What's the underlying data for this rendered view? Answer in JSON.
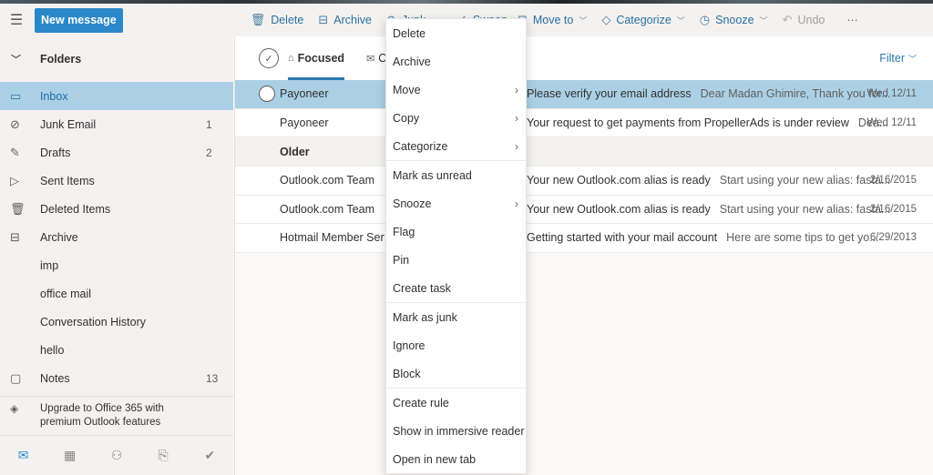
{
  "toolbar": {
    "menu_icon": "☰",
    "new_message": "New message",
    "commands": [
      {
        "icon": "🗑",
        "label": "Delete",
        "dropdown": false,
        "disabled": false
      },
      {
        "icon": "⊟",
        "label": "Archive",
        "dropdown": false,
        "disabled": false
      },
      {
        "icon": "⊘",
        "label": "Junk",
        "dropdown": true,
        "disabled": false
      },
      {
        "icon": "✓",
        "label": "Sweep",
        "dropdown": false,
        "disabled": false
      },
      {
        "icon": "⊡",
        "label": "Move to",
        "dropdown": true,
        "disabled": false
      },
      {
        "icon": "◇",
        "label": "Categorize",
        "dropdown": true,
        "disabled": false
      },
      {
        "icon": "◷",
        "label": "Snooze",
        "dropdown": true,
        "disabled": false
      },
      {
        "icon": "↶",
        "label": "Undo",
        "dropdown": false,
        "disabled": true
      }
    ],
    "more_icon": "···"
  },
  "sidebar": {
    "header": "Folders",
    "items": [
      {
        "icon": "▭",
        "label": "Inbox",
        "count": "",
        "selected": true
      },
      {
        "icon": "⊘",
        "label": "Junk Email",
        "count": "1",
        "selected": false
      },
      {
        "icon": "✎",
        "label": "Drafts",
        "count": "2",
        "selected": false
      },
      {
        "icon": "▷",
        "label": "Sent Items",
        "count": "",
        "selected": false
      },
      {
        "icon": "🗑",
        "label": "Deleted Items",
        "count": "",
        "selected": false
      },
      {
        "icon": "⊟",
        "label": "Archive",
        "count": "",
        "selected": false
      },
      {
        "icon": "",
        "label": "imp",
        "count": "",
        "selected": false
      },
      {
        "icon": "",
        "label": "office mail",
        "count": "",
        "selected": false
      },
      {
        "icon": "",
        "label": "Conversation History",
        "count": "",
        "selected": false
      },
      {
        "icon": "",
        "label": "hello",
        "count": "",
        "selected": false
      },
      {
        "icon": "▢",
        "label": "Notes",
        "count": "13",
        "selected": false
      }
    ],
    "upgrade": {
      "icon": "◈",
      "line1": "Upgrade to Office 365 with",
      "line2": "premium Outlook features"
    },
    "bottom_nav": [
      {
        "name": "mail-icon",
        "glyph": "✉",
        "active": true
      },
      {
        "name": "calendar-icon",
        "glyph": "▦",
        "active": false
      },
      {
        "name": "people-icon",
        "glyph": "⚇",
        "active": false
      },
      {
        "name": "attachment-icon",
        "glyph": "⎘",
        "active": false
      },
      {
        "name": "todo-icon",
        "glyph": "✔",
        "active": false
      }
    ]
  },
  "main": {
    "tabs": [
      {
        "icon": "⌂",
        "label": "Focused",
        "active": true
      },
      {
        "icon": "✉",
        "label": "Other",
        "active": false
      }
    ],
    "filter": "Filter",
    "messages_recent": [
      {
        "sender": "Payoneer",
        "subject": "Please verify your email address",
        "preview": "Dear Madan Ghimire, Thank you for...",
        "date": "Wed 12/11",
        "selected": true
      },
      {
        "sender": "Payoneer",
        "subject": "Your request to get payments from PropellerAds is under review",
        "preview": "Dea...",
        "date": "Wed 12/11",
        "selected": false
      }
    ],
    "group_older": "Older",
    "messages_older": [
      {
        "sender": "Outlook.com Team",
        "subject": "Your new Outlook.com alias is ready",
        "preview": "Start using your new alias: fasta...",
        "date": "2/16/2015"
      },
      {
        "sender": "Outlook.com Team",
        "subject": "Your new Outlook.com alias is ready",
        "preview": "Start using your new alias: fasta...",
        "date": "2/16/2015"
      },
      {
        "sender": "Hotmail Member Services",
        "subject": "Getting started with your mail account",
        "preview": "Here are some tips to get yo...",
        "date": "6/29/2013"
      }
    ]
  },
  "context_menu": {
    "groups": [
      [
        {
          "label": "Delete",
          "submenu": false
        },
        {
          "label": "Archive",
          "submenu": false
        },
        {
          "label": "Move",
          "submenu": true
        },
        {
          "label": "Copy",
          "submenu": true
        },
        {
          "label": "Categorize",
          "submenu": true
        }
      ],
      [
        {
          "label": "Mark as unread",
          "submenu": false
        },
        {
          "label": "Snooze",
          "submenu": true
        },
        {
          "label": "Flag",
          "submenu": false
        },
        {
          "label": "Pin",
          "submenu": false
        },
        {
          "label": "Create task",
          "submenu": false
        }
      ],
      [
        {
          "label": "Mark as junk",
          "submenu": false
        },
        {
          "label": "Ignore",
          "submenu": false
        },
        {
          "label": "Block",
          "submenu": false
        }
      ],
      [
        {
          "label": "Create rule",
          "submenu": false
        },
        {
          "label": "Show in immersive reader",
          "submenu": false
        },
        {
          "label": "Open in new tab",
          "submenu": false
        }
      ]
    ]
  }
}
